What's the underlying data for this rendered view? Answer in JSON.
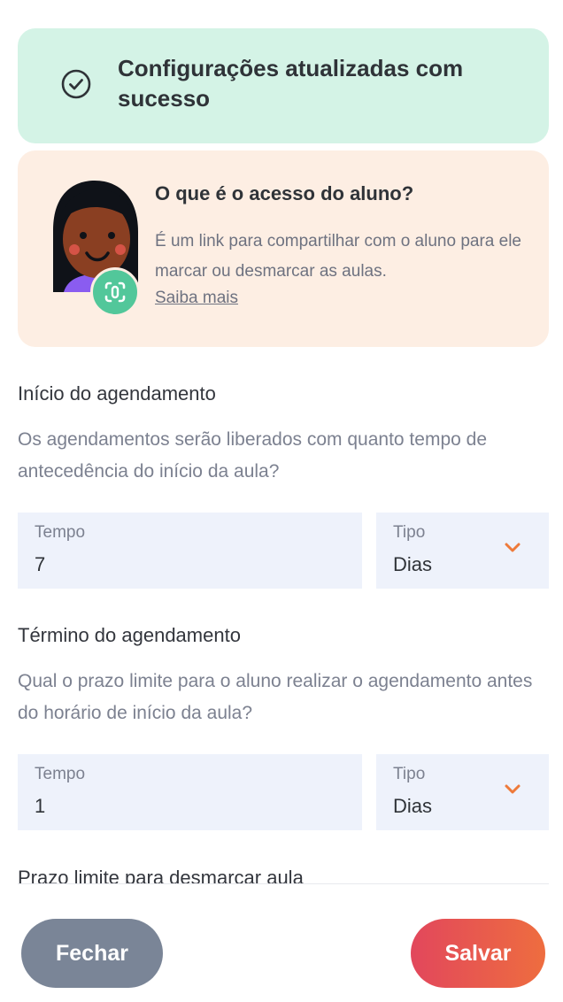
{
  "toast": {
    "message": "Configurações atualizadas com sucesso",
    "icon": "check-circle-icon"
  },
  "info_card": {
    "title": "O que é o acesso do aluno?",
    "description": "É um link para compartilhar com o aluno para ele marcar ou desmarcar as aulas.",
    "link_label": "Saiba mais",
    "avatar": "student-avatar",
    "badge_icon": "scan-icon"
  },
  "start_section": {
    "title": "Início do agendamento",
    "description": "Os agendamentos serão liberados com quanto tempo de antecedência do início da aula?",
    "time_label": "Tempo",
    "time_value": "7",
    "type_label": "Tipo",
    "type_value": "Dias"
  },
  "end_section": {
    "title": "Término do agendamento",
    "description": "Qual o prazo limite para o aluno realizar o agendamento antes do horário de início da aula?",
    "time_label": "Tempo",
    "time_value": "1",
    "type_label": "Tipo",
    "type_value": "Dias"
  },
  "cancel_section": {
    "title": "Prazo limite para desmarcar aula"
  },
  "footer": {
    "close_label": "Fechar",
    "save_label": "Salvar"
  },
  "colors": {
    "toast_bg": "#d4f3e6",
    "card_bg": "#fdeee3",
    "field_bg": "#eef2fb",
    "accent_orange": "#ee7a3a",
    "save_gradient_start": "#e2475c",
    "save_gradient_end": "#ee6d3f",
    "close_bg": "#7a8597",
    "badge_green": "#52c79a"
  }
}
